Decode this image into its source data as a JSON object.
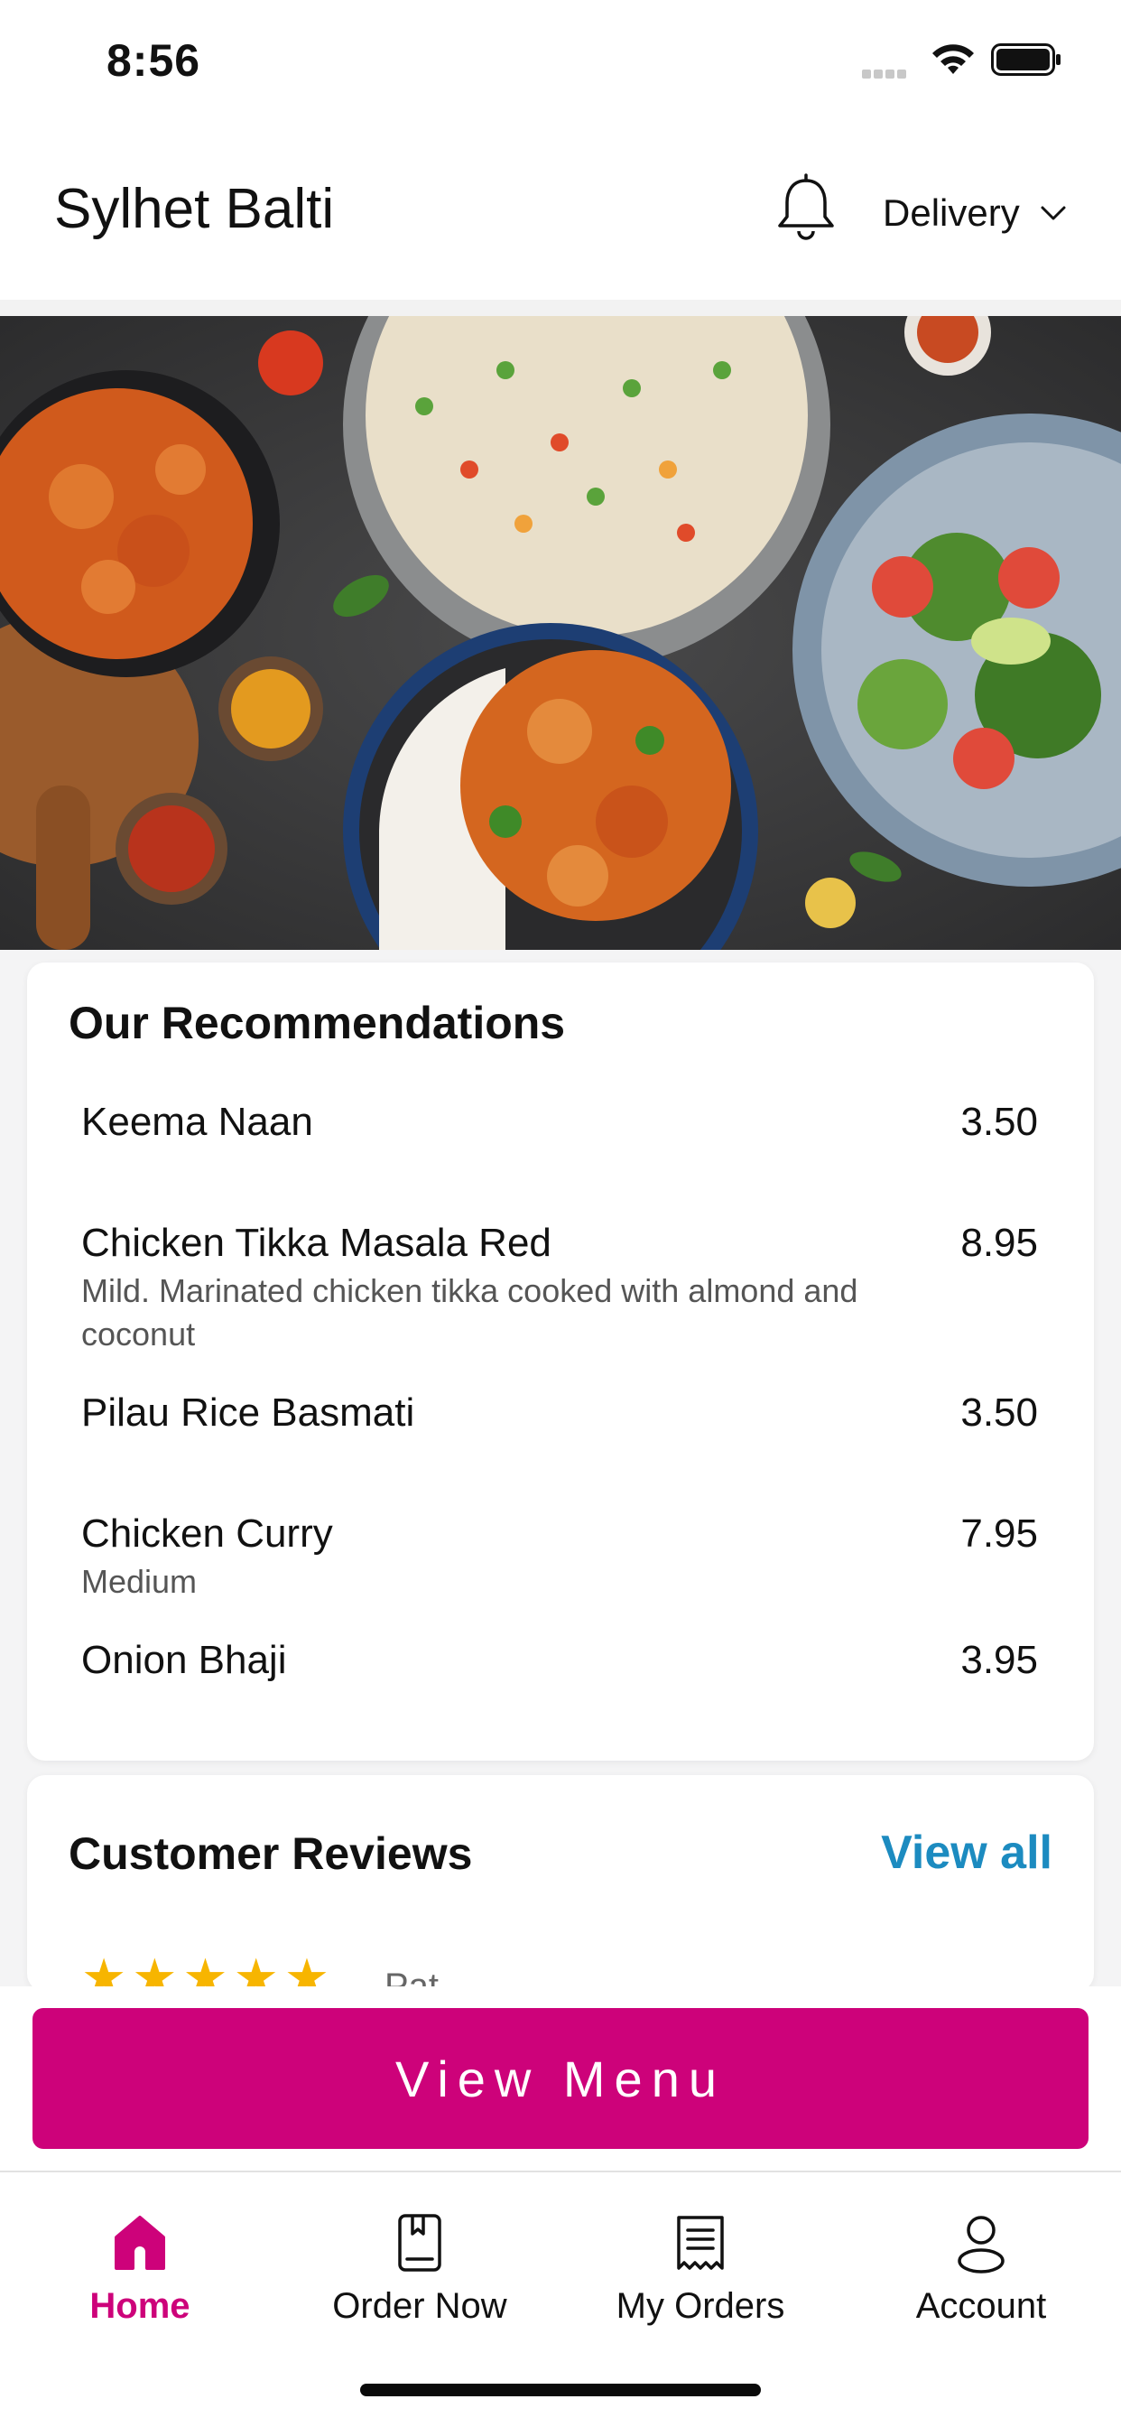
{
  "status_bar": {
    "time": "8:56"
  },
  "header": {
    "store_name": "Sylhet Balti",
    "order_type": "Delivery",
    "icons": [
      "bell-icon",
      "chevron-down-icon"
    ]
  },
  "hero": {
    "image": "food-spread-photo"
  },
  "recommendations": {
    "title": "Our Recommendations",
    "items": [
      {
        "name": "Keema Naan",
        "description": "",
        "price": "3.50"
      },
      {
        "name": "Chicken Tikka Masala Red",
        "description": "Mild. Marinated chicken tikka cooked with almond and coconut",
        "price": "8.95"
      },
      {
        "name": "Pilau Rice Basmati",
        "description": "",
        "price": "3.50"
      },
      {
        "name": "Chicken Curry",
        "description": "Medium",
        "price": "7.95"
      },
      {
        "name": "Onion Bhaji",
        "description": "",
        "price": "3.95"
      }
    ]
  },
  "reviews": {
    "title": "Customer Reviews",
    "view_all": "View all",
    "first_review": {
      "rating": 5,
      "reviewer": "Pat"
    }
  },
  "cta": {
    "label": "View Menu"
  },
  "tab_bar": {
    "tabs": [
      {
        "label": "Home",
        "icon": "home-icon",
        "active": true
      },
      {
        "label": "Order Now",
        "icon": "order-book-icon",
        "active": false
      },
      {
        "label": "My Orders",
        "icon": "receipt-icon",
        "active": false
      },
      {
        "label": "Account",
        "icon": "person-icon",
        "active": false
      }
    ]
  },
  "colors": {
    "accent": "#cd027a",
    "link": "#1c8bc0",
    "star": "#f7b500"
  }
}
